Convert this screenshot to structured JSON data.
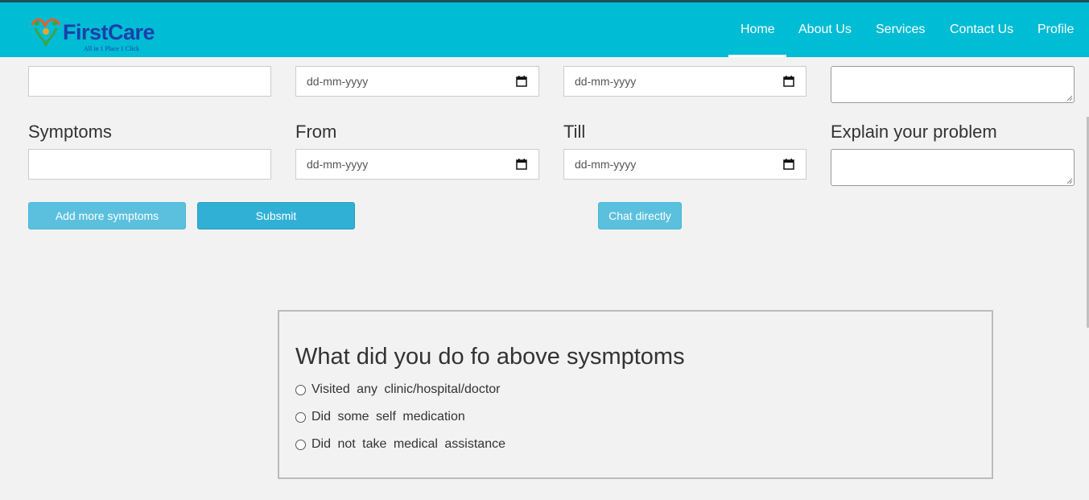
{
  "brand": {
    "name": "FirstCare",
    "tagline": "All in 1 Place 1 Click"
  },
  "nav": {
    "items": [
      {
        "label": "Home",
        "active": true
      },
      {
        "label": "About Us"
      },
      {
        "label": "Services"
      },
      {
        "label": "Contact Us"
      },
      {
        "label": "Profile"
      }
    ]
  },
  "form": {
    "row1": {
      "date1_placeholder": "dd-mm-yyyy",
      "date2_placeholder": "dd-mm-yyyy"
    },
    "row2": {
      "symptoms_label": "Symptoms",
      "from_label": "From",
      "till_label": "Till",
      "explain_label": "Explain your problem",
      "from_placeholder": "dd-mm-yyyy",
      "till_placeholder": "dd-mm-yyyy"
    },
    "buttons": {
      "add_more": "Add more symptoms",
      "submit": "Subsmit",
      "chat": "Chat directly"
    }
  },
  "question": {
    "title": "What did you do fo above sysmptoms",
    "options": [
      "Visited any clinic/hospital/doctor",
      "Did some self medication",
      "Did not take medical assistance"
    ]
  },
  "colors": {
    "navbar": "#00bcd4",
    "button_light": "#5bc0de",
    "button_dark": "#31b0d5",
    "brand_text": "#1c3faa"
  }
}
